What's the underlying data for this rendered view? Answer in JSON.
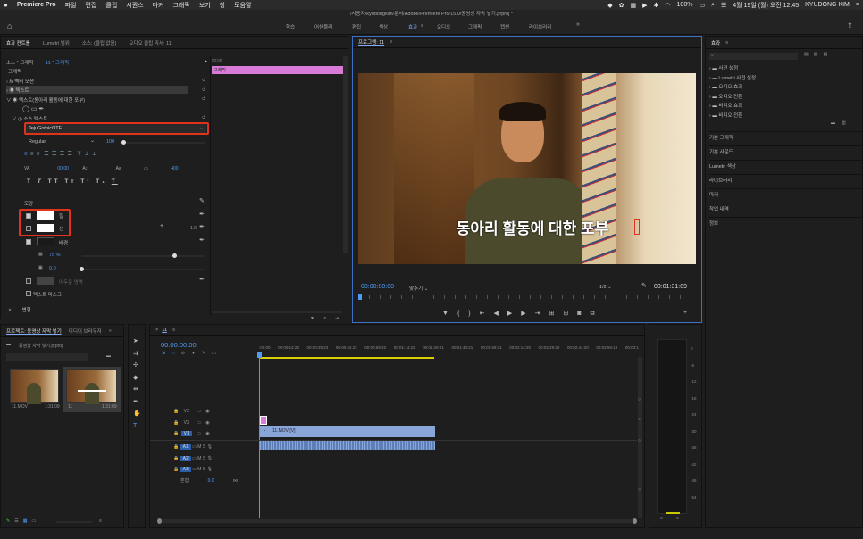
{
  "menubar": {
    "app_name": "Premiere Pro",
    "items": [
      "파일",
      "편집",
      "클립",
      "시퀀스",
      "마커",
      "그래픽",
      "보기",
      "창",
      "도움말"
    ],
    "battery": "100%",
    "date": "4월 19일 (월) 오전 12:45",
    "user": "KYUDONG KIM"
  },
  "title_path": "/사용자/kyudongkim/문서/Adobe/Premiere Pro/15.0/동영상 자막 넣기.prproj *",
  "workspaces": [
    "학습",
    "어셈블리",
    "편집",
    "색상",
    "효과",
    "오디오",
    "그래픽",
    "캡션",
    "라이브러리"
  ],
  "workspace_active": "효과",
  "effect_controls": {
    "tabs": [
      "효과 컨트롤",
      "Lumetri 범위",
      "소스: (클립 없음)",
      "오디오 클립 믹서: 11"
    ],
    "source_label": "소스 * 그래픽",
    "sequence_label": "11 * 그래픽",
    "section_graphic": "그래픽",
    "vector_motion": "벡터 모션",
    "text_layer": "텍스트",
    "text_layer_detail": "텍스트(동아리 활동에 대한 포부)",
    "source_text": "소스 텍스트",
    "font": "JejuGothicOTF",
    "font_style": "Regular",
    "font_size": "100",
    "tracking": "400",
    "appearance_label": "모양",
    "fill_label": "칠",
    "stroke_label": "선",
    "background_label": "배경",
    "opacity": "75 %",
    "size_value": "0.0",
    "stroke_width": "1.0",
    "shadow_label": "어두운 영역",
    "text_mask_label": "텍스트 마스크",
    "transform_label": "변형",
    "timecode_zero": "00:00"
  },
  "program_monitor": {
    "tab": "프로그램: 11",
    "caption": "동아리 활동에 대한 포부",
    "current_time": "00:00:00:00",
    "fit": "맞추기",
    "quality": "1/2",
    "duration": "00:01:31:09"
  },
  "effects_panel": {
    "tab": "효과",
    "folders": [
      "사전 설정",
      "Lumetri 사전 설정",
      "오디오 효과",
      "오디오 전환",
      "비디오 효과",
      "비디오 전환"
    ],
    "sections": [
      "기본 그래픽",
      "기본 사운드",
      "Lumetri 색상",
      "라이브러리",
      "마커",
      "작업 내역",
      "정보"
    ]
  },
  "project_panel": {
    "tabs": [
      "프로젝트: 동영상 자막 넣기",
      "미디어 브라우저"
    ],
    "project_file": "동영상 자막 넣기.prproj",
    "clips": [
      {
        "name": "11.MOV",
        "duration": "1:31:09"
      },
      {
        "name": "11",
        "duration": "1:31:09"
      }
    ]
  },
  "timeline": {
    "tab": "11",
    "timecode": "00:00:00:00",
    "ruler": [
      ":00:00",
      "00:00:14:23",
      "00:00:29:23",
      "00:00:44:22",
      "00:00:59:22",
      "00:01:14:22",
      "00:01:29:21",
      "00:01:44:21",
      "00:01:59:21",
      "00:02:14:20",
      "00:02:29:20",
      "00:02:44:20",
      "00:02:59:19",
      "00:03:1"
    ],
    "video_tracks": [
      "V3",
      "V2",
      "V1"
    ],
    "audio_tracks": [
      "A1",
      "A2",
      "A3"
    ],
    "mix_label": "혼합",
    "mix_value": "0.0",
    "clip_label": "11.MOV [V]",
    "track_buttons": {
      "mute": "M",
      "solo": "S"
    }
  },
  "audio_meter": {
    "scale": [
      "0",
      "-6",
      "-12",
      "-18",
      "-24",
      "-30",
      "-36",
      "-42",
      "-48",
      "-54",
      "dB"
    ],
    "solo": [
      "S",
      "S"
    ]
  },
  "colors": {
    "accent": "#4f9bf1",
    "highlight": "#e0321e",
    "graphic_clip": "#d87ad8",
    "video_clip": "#8aa6d8"
  }
}
